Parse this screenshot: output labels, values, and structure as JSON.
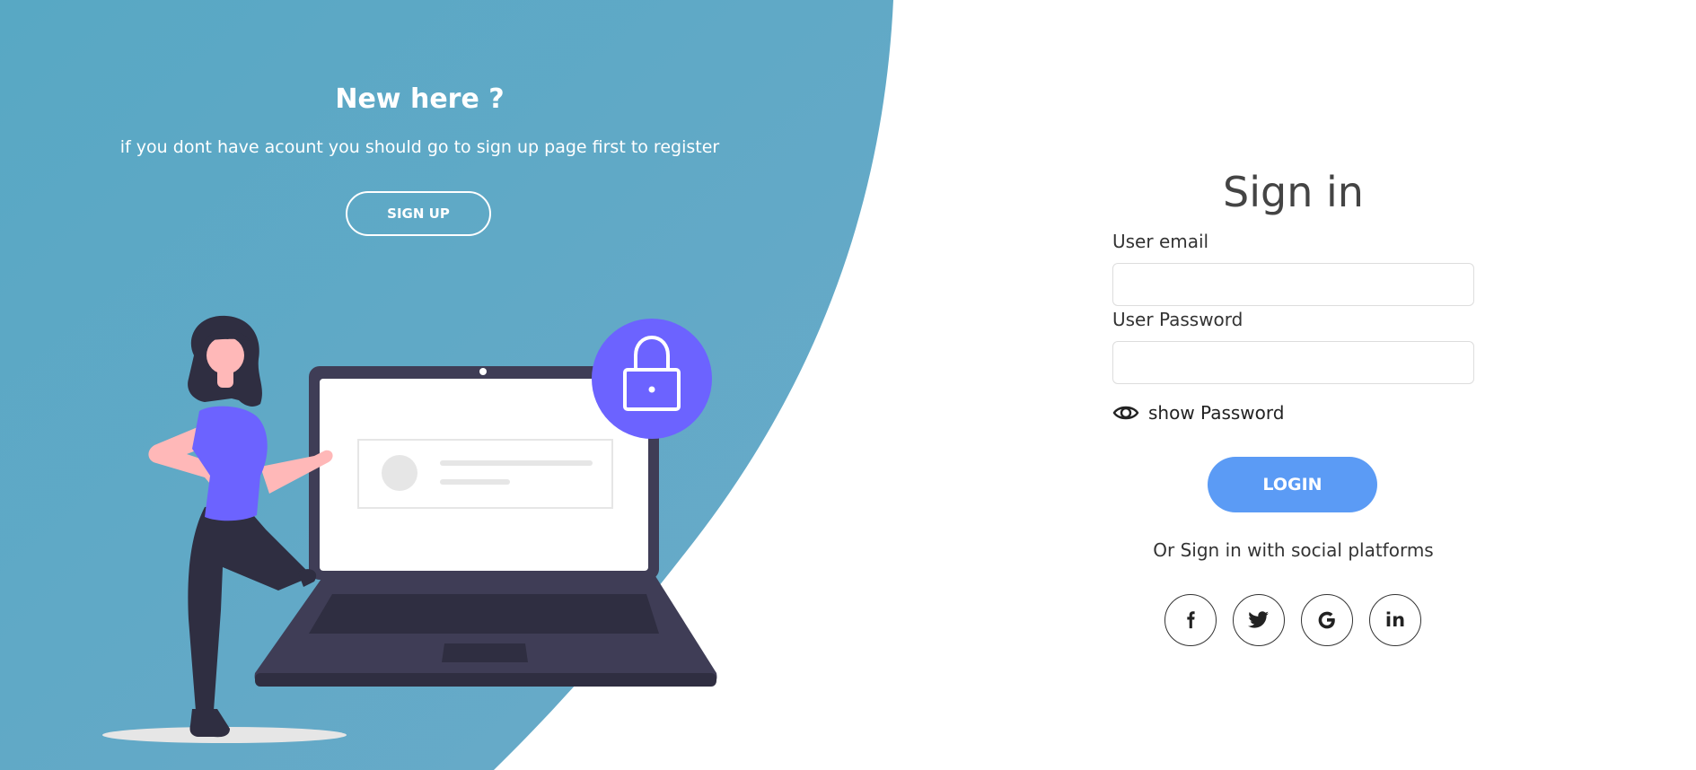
{
  "colors": {
    "panel_background": "#5ea9c5",
    "accent_purple": "#6c63ff",
    "login_button": "#5b9bf5"
  },
  "left_panel": {
    "title": "New here ?",
    "text": "if you dont have acount you should go to sign up page first to register",
    "signup_label": "SIGN UP",
    "illustration": "woman-with-laptop-and-lock-illustration"
  },
  "form": {
    "title": "Sign in",
    "email_label": "User email",
    "email_value": "",
    "password_label": "User Password",
    "password_value": "",
    "show_password_label": "show Password",
    "show_password_icon": "eye-icon",
    "login_label": "LOGIN",
    "social_text": "Or Sign in with social platforms",
    "socials": [
      {
        "name": "facebook",
        "icon": "facebook-icon"
      },
      {
        "name": "twitter",
        "icon": "twitter-icon"
      },
      {
        "name": "google",
        "icon": "google-icon"
      },
      {
        "name": "linkedin",
        "icon": "linkedin-icon",
        "glyph": "in"
      }
    ]
  }
}
